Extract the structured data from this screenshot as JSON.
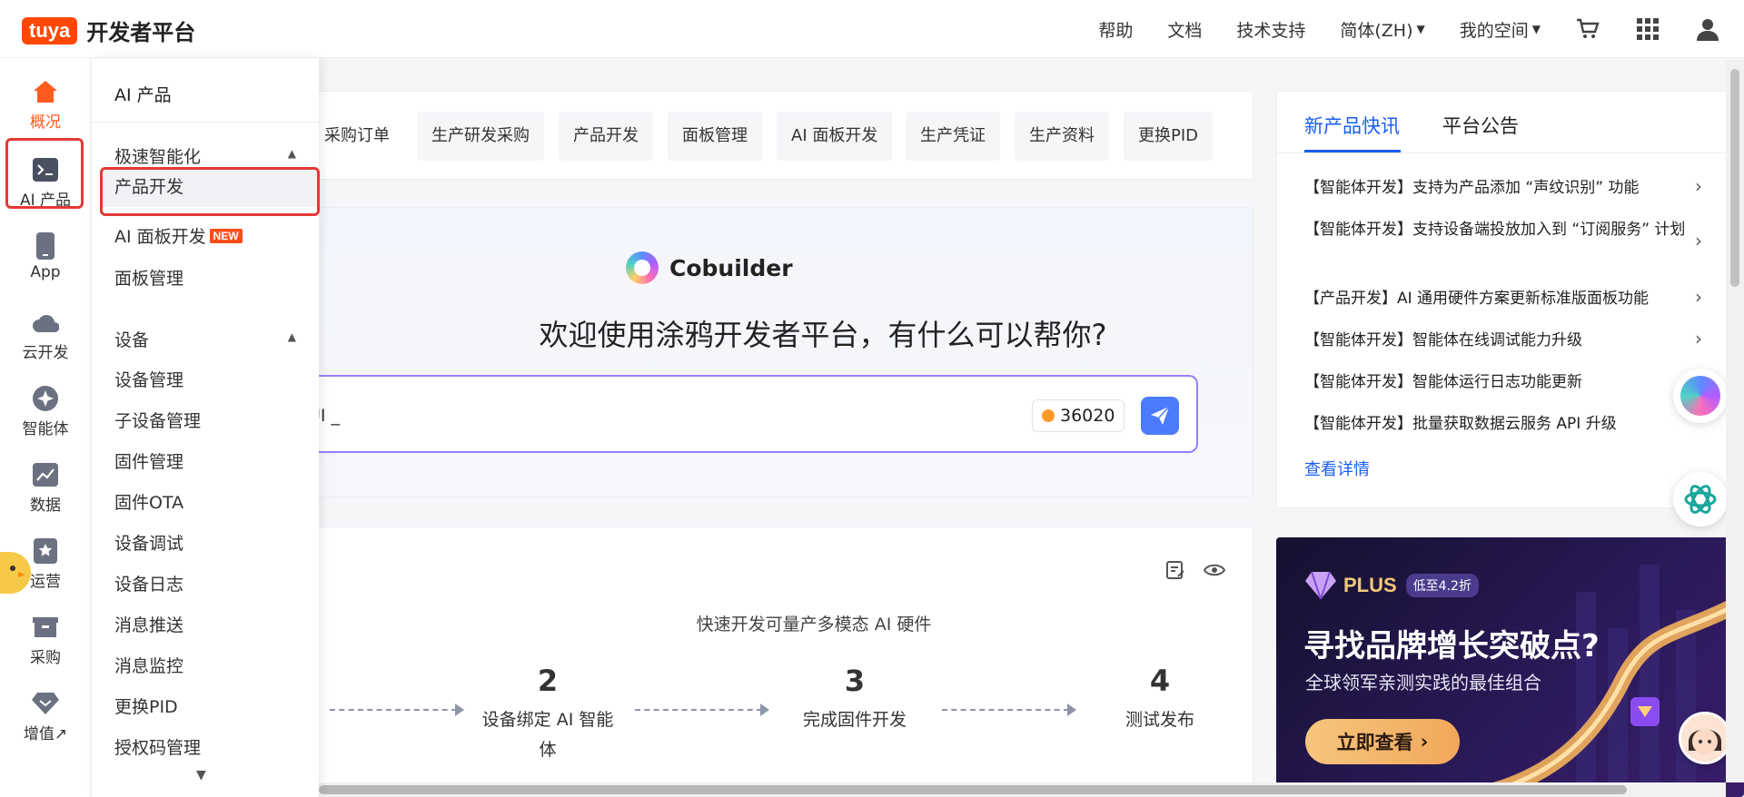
{
  "header": {
    "logo_text": "tuya",
    "title": "开发者平台",
    "nav": [
      {
        "label": "帮助"
      },
      {
        "label": "文档"
      },
      {
        "label": "技术支持"
      },
      {
        "label": "简体(ZH)"
      },
      {
        "label": "我的空间"
      }
    ]
  },
  "rail": [
    {
      "label": "概况"
    },
    {
      "label": "AI 产品"
    },
    {
      "label": "App"
    },
    {
      "label": "云开发"
    },
    {
      "label": "智能体"
    },
    {
      "label": "数据"
    },
    {
      "label": "运营"
    },
    {
      "label": "采购"
    },
    {
      "label": "增值↗"
    }
  ],
  "submenu": {
    "title": "AI 产品",
    "group1": "极速智能化",
    "group1_items": [
      "产品开发",
      "AI 面板开发",
      "面板管理"
    ],
    "new_badge": "NEW",
    "group2": "设备",
    "group2_items": [
      "设备管理",
      "子设备管理",
      "固件管理",
      "固件OTA",
      "设备调试",
      "设备日志",
      "消息推送",
      "消息监控",
      "更换PID",
      "授权码管理"
    ]
  },
  "quick_tabs": [
    "采购订单",
    "生产研发采购",
    "产品开发",
    "面板管理",
    "AI 面板开发",
    "生产凭证",
    "生产资料",
    "更换PID"
  ],
  "cobuilder": {
    "brand": "Cobuilder",
    "welcome": "欢迎使用涂鸦开发者平台，有什么可以帮你?",
    "input_text": "备的UI _",
    "tokens": "36020"
  },
  "steps": {
    "subtitle": "快速开发可量产多模态 AI 硬件",
    "items": [
      {
        "num": "2",
        "label": "设备绑定 AI 智能体"
      },
      {
        "num": "3",
        "label": "完成固件开发"
      },
      {
        "num": "4",
        "label": "测试发布"
      }
    ]
  },
  "news": {
    "tabs": [
      "新产品快讯",
      "平台公告"
    ],
    "items": [
      "【智能体开发】支持为产品添加 “声纹识别” 功能",
      "【智能体开发】支持设备端投放加入到 “订阅服务” 计划",
      "【产品开发】AI 通用硬件方案更新标准版面板功能",
      "【智能体开发】智能体在线调试能力升级",
      "【智能体开发】智能体运行日志功能更新",
      "【智能体开发】批量获取数据云服务 API 升级"
    ],
    "more": "查看详情"
  },
  "banner": {
    "plus": "PLUS",
    "discount": "低至4.2折",
    "title": "寻找品牌增长突破点?",
    "subtitle": "全球领军亲测实践的最佳组合",
    "cta": "立即查看"
  },
  "colors": {
    "brand": "#ff4800",
    "accent": "#1a5ef3",
    "active_rail": "#ff5a1f",
    "highlight": "#e53935"
  }
}
